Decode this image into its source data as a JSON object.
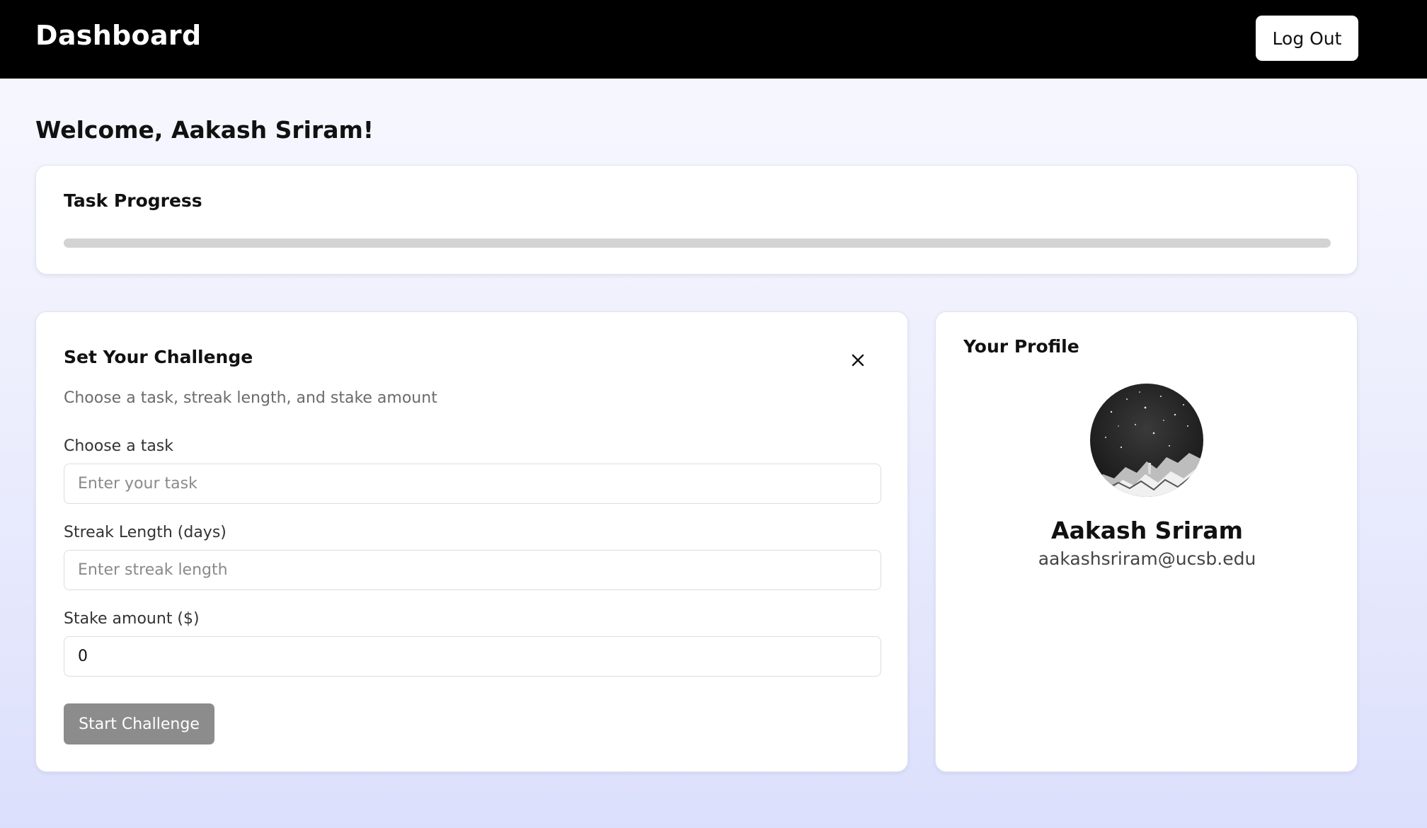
{
  "header": {
    "title": "Dashboard",
    "logout_label": "Log Out"
  },
  "welcome": "Welcome, Aakash Sriram!",
  "progress": {
    "title": "Task Progress",
    "fraction": 0
  },
  "challenge": {
    "title": "Set Your Challenge",
    "subtitle": "Choose a task, streak length, and stake amount",
    "task": {
      "label": "Choose a task",
      "placeholder": "Enter your task",
      "value": ""
    },
    "streak": {
      "label": "Streak Length (days)",
      "placeholder": "Enter streak length",
      "value": ""
    },
    "stake": {
      "label": "Stake amount ($)",
      "placeholder": "",
      "value": "0"
    },
    "start_label": "Start Challenge",
    "close_icon": "close-icon"
  },
  "profile": {
    "title": "Your Profile",
    "name": "Aakash Sriram",
    "email": "aakashsriram@ucsb.edu",
    "avatar_icon": "avatar"
  },
  "colors": {
    "topbar": "#000000",
    "button_disabled": "#8c8c8c",
    "progress_track": "#d3d3d3"
  }
}
